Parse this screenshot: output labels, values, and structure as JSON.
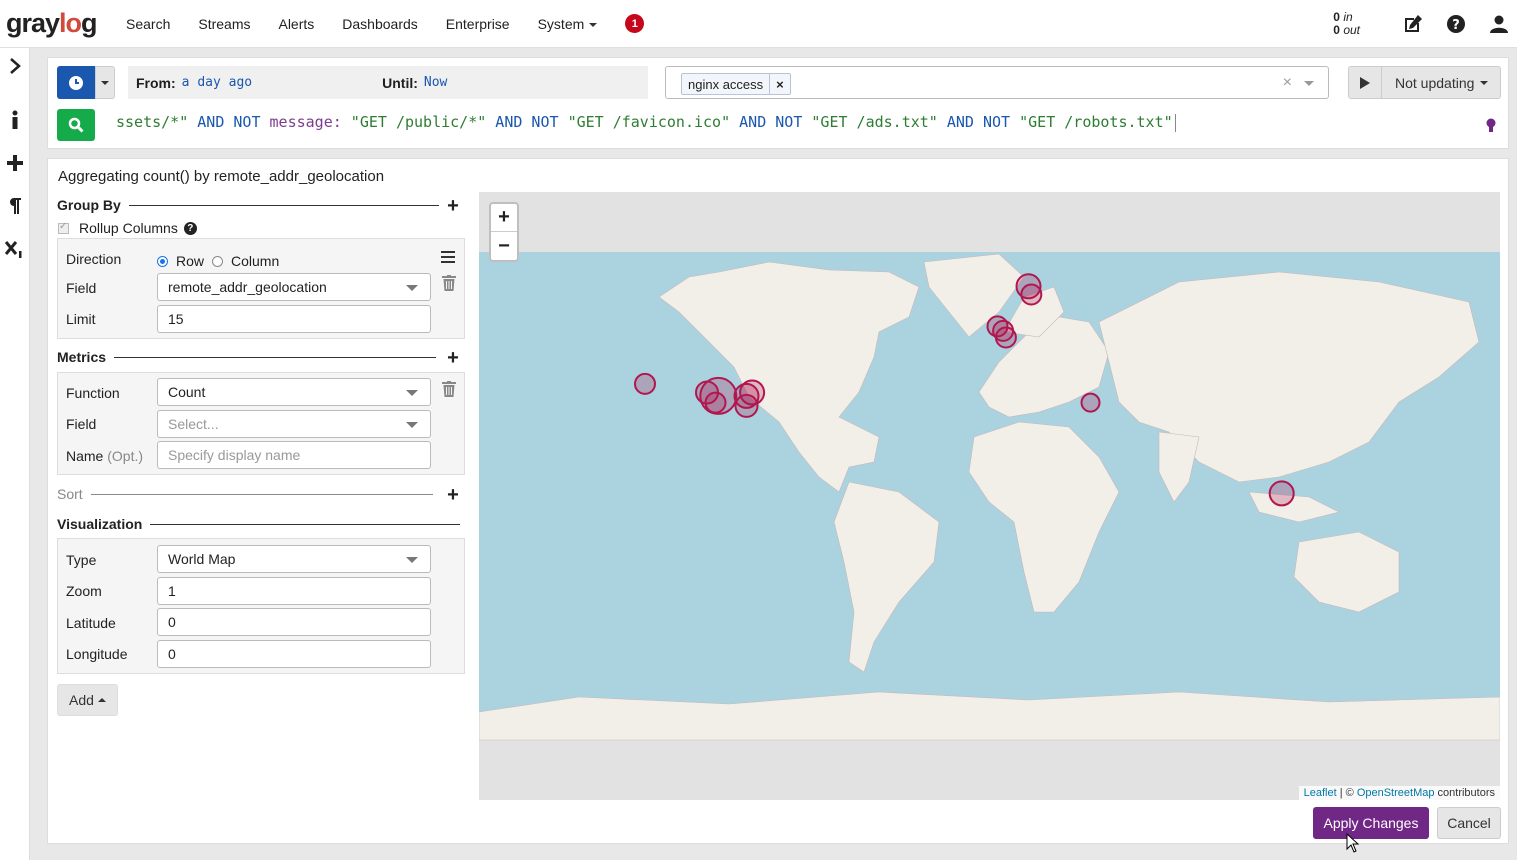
{
  "nav": {
    "logo_a": "gray",
    "logo_o": "lo",
    "logo_b": "g",
    "items": [
      "Search",
      "Streams",
      "Alerts",
      "Dashboards",
      "Enterprise"
    ],
    "system_label": "System",
    "notifications_count": "1",
    "throughput_in_value": "0",
    "throughput_in_label": "in",
    "throughput_out_value": "0",
    "throughput_out_label": "out"
  },
  "search": {
    "from_label": "From:",
    "from_value": "a day ago",
    "until_label": "Until:",
    "until_value": "Now",
    "stream_tag": "nginx access",
    "refresh_label": "Not updating",
    "query_tokens": [
      {
        "t": "ssets/*\"",
        "c": "str"
      },
      {
        "t": " AND NOT ",
        "c": "kw"
      },
      {
        "t": "message:",
        "c": "fld"
      },
      {
        "t": " \"GET /public/*\"",
        "c": "str"
      },
      {
        "t": " AND NOT ",
        "c": "kw"
      },
      {
        "t": "\"GET /favicon.ico\"",
        "c": "str"
      },
      {
        "t": " AND NOT ",
        "c": "kw"
      },
      {
        "t": "\"GET /ads.txt\"",
        "c": "str"
      },
      {
        "t": " AND NOT ",
        "c": "kw"
      },
      {
        "t": "\"GET /robots.txt\"",
        "c": "str"
      }
    ]
  },
  "widget": {
    "title": "Aggregating count() by remote_addr_geolocation",
    "group_by": {
      "heading": "Group By",
      "rollup_label": "Rollup Columns",
      "direction_label": "Direction",
      "direction_options": [
        "Row",
        "Column"
      ],
      "direction_selected": "Row",
      "field_label": "Field",
      "field_value": "remote_addr_geolocation",
      "limit_label": "Limit",
      "limit_value": "15"
    },
    "metrics": {
      "heading": "Metrics",
      "function_label": "Function",
      "function_value": "Count",
      "field_label": "Field",
      "field_placeholder": "Select...",
      "name_label": "Name",
      "name_opt": "(Opt.)",
      "name_placeholder": "Specify display name"
    },
    "sort": {
      "heading": "Sort"
    },
    "visualization": {
      "heading": "Visualization",
      "type_label": "Type",
      "type_value": "World Map",
      "zoom_label": "Zoom",
      "zoom_value": "1",
      "latitude_label": "Latitude",
      "latitude_value": "0",
      "longitude_label": "Longitude",
      "longitude_value": "0"
    },
    "add_label": "Add",
    "apply_label": "Apply Changes",
    "cancel_label": "Cancel"
  },
  "map": {
    "zoom_in": "+",
    "zoom_out": "−",
    "attribution_leaflet": "Leaflet",
    "attribution_sep": " | © ",
    "attribution_osm": "OpenStreetMap",
    "attribution_tail": " contributors",
    "marker_color": "#b0174f",
    "markers": [
      {
        "lat": 37.5,
        "lon": -122,
        "r": 10
      },
      {
        "lat": 34,
        "lon": -96,
        "r": 18
      },
      {
        "lat": 35,
        "lon": -100,
        "r": 11
      },
      {
        "lat": 32,
        "lon": -97,
        "r": 10
      },
      {
        "lat": 34,
        "lon": -86,
        "r": 12
      },
      {
        "lat": 35,
        "lon": -84,
        "r": 12
      },
      {
        "lat": 31,
        "lon": -86,
        "r": 11
      },
      {
        "lat": 52,
        "lon": 3,
        "r": 10
      },
      {
        "lat": 51,
        "lon": 5,
        "r": 10
      },
      {
        "lat": 49.5,
        "lon": 6,
        "r": 10
      },
      {
        "lat": 60,
        "lon": 14,
        "r": 12
      },
      {
        "lat": 58.5,
        "lon": 15,
        "r": 10
      },
      {
        "lat": 32,
        "lon": 36,
        "r": 9
      },
      {
        "lat": 1.3,
        "lon": 103.8,
        "r": 12
      }
    ]
  }
}
